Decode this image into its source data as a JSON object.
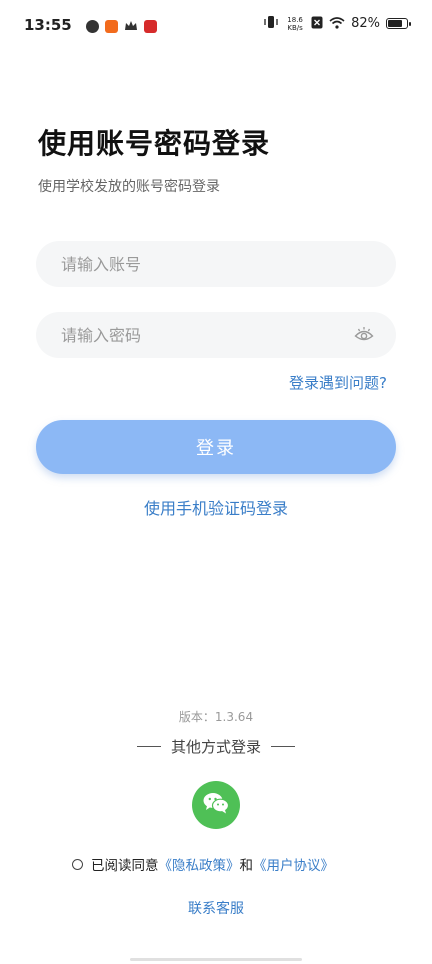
{
  "status_bar": {
    "time": "13:55",
    "net_speed_value": "18.6",
    "net_speed_unit": "KB/s",
    "battery_percent": "82%",
    "battery_level": 0.82,
    "icons": [
      "leaf-app-icon",
      "orange-app-icon",
      "crown-icon",
      "red-app-icon",
      "vibrate-icon",
      "close-x-icon",
      "wifi-icon",
      "battery-icon"
    ]
  },
  "header": {
    "title": "使用账号密码登录",
    "subtitle": "使用学校发放的账号密码登录"
  },
  "form": {
    "account_placeholder": "请输入账号",
    "password_placeholder": "请输入密码",
    "help_link": "登录遇到问题?",
    "login_button": "登录",
    "phone_login_link": "使用手机验证码登录"
  },
  "footer": {
    "version": "版本：1.3.64",
    "other_login_label": "其他方式登录",
    "agreement_prefix": "已阅读同意",
    "privacy_policy": "《隐私政策》",
    "agreement_and": "和",
    "user_agreement": "《用户协议》",
    "support_link": "联系客服"
  },
  "colors": {
    "accent": "#3a7ec8",
    "button": "#8cb8f5",
    "wechat": "#4fc056",
    "input_bg": "#f5f6f7"
  }
}
